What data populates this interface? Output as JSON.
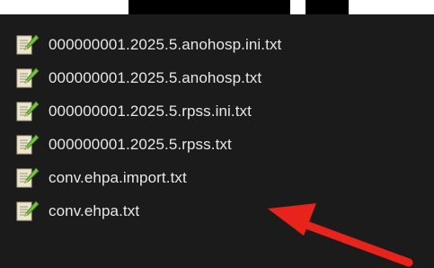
{
  "files": [
    {
      "name": "000000001.2025.5.anohosp.ini.txt",
      "icon": "text-file-icon"
    },
    {
      "name": "000000001.2025.5.anohosp.txt",
      "icon": "text-file-icon"
    },
    {
      "name": "000000001.2025.5.rpss.ini.txt",
      "icon": "text-file-icon"
    },
    {
      "name": "000000001.2025.5.rpss.txt",
      "icon": "text-file-icon"
    },
    {
      "name": "conv.ehpa.import.txt",
      "icon": "text-file-icon"
    },
    {
      "name": "conv.ehpa.txt",
      "icon": "text-file-icon"
    }
  ],
  "colors": {
    "background": "#1b1b1b",
    "text": "#e7e7e7",
    "arrow": "#e8231b",
    "icon_paper": "#e9e3c8",
    "icon_pencil": "#7cc04a"
  },
  "annotation": {
    "icon": "red-arrow-icon",
    "points_to": "conv.ehpa.import.txt"
  }
}
